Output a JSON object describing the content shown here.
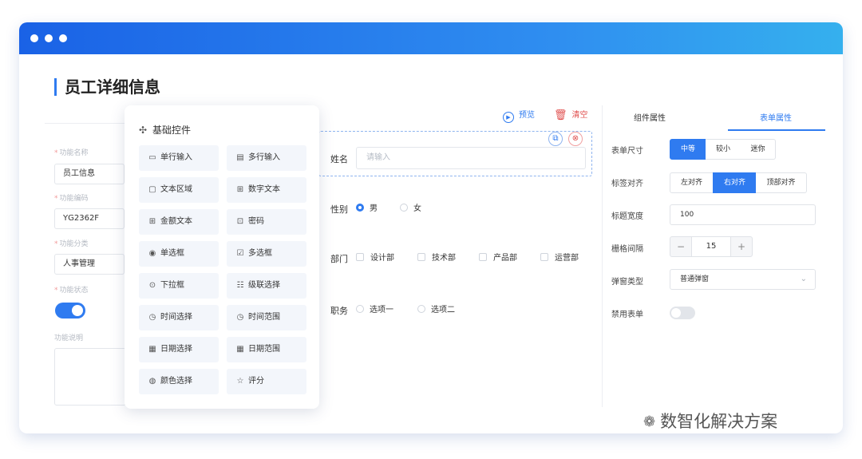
{
  "page": {
    "title": "员工详细信息"
  },
  "left_form": {
    "fields": [
      {
        "label": "功能名称",
        "value": "员工信息"
      },
      {
        "label": "功能编码",
        "value": "YG2362F"
      },
      {
        "label": "功能分类",
        "value": "人事管理"
      }
    ],
    "status_label": "功能状态",
    "status_on": true,
    "desc_label": "功能说明"
  },
  "popup": {
    "title": "基础控件",
    "controls": [
      {
        "label": "单行输入",
        "icon": "single-line-input-icon",
        "glyph": "▭"
      },
      {
        "label": "多行输入",
        "icon": "multi-line-input-icon",
        "glyph": "▤"
      },
      {
        "label": "文本区域",
        "icon": "text-area-icon",
        "glyph": "▢"
      },
      {
        "label": "数字文本",
        "icon": "number-text-icon",
        "glyph": "⊞"
      },
      {
        "label": "金额文本",
        "icon": "amount-text-icon",
        "glyph": "⊞"
      },
      {
        "label": "密码",
        "icon": "password-icon",
        "glyph": "⊡"
      },
      {
        "label": "单选框",
        "icon": "radio-icon",
        "glyph": "◉"
      },
      {
        "label": "多选框",
        "icon": "checkbox-icon",
        "glyph": "☑"
      },
      {
        "label": "下拉框",
        "icon": "dropdown-icon",
        "glyph": "⊙"
      },
      {
        "label": "级联选择",
        "icon": "cascade-select-icon",
        "glyph": "☷"
      },
      {
        "label": "时间选择",
        "icon": "time-select-icon",
        "glyph": "◷"
      },
      {
        "label": "时间范围",
        "icon": "time-range-icon",
        "glyph": "◷"
      },
      {
        "label": "日期选择",
        "icon": "date-select-icon",
        "glyph": "▦"
      },
      {
        "label": "日期范围",
        "icon": "date-range-icon",
        "glyph": "▦"
      },
      {
        "label": "颜色选择",
        "icon": "color-select-icon",
        "glyph": "◍"
      },
      {
        "label": "评分",
        "icon": "star-icon",
        "glyph": "☆"
      }
    ]
  },
  "center": {
    "preview_label": "预览",
    "clear_label": "清空",
    "name_label": "姓名",
    "name_placeholder": "请输入",
    "gender_label": "性别",
    "gender_options": [
      "男",
      "女"
    ],
    "gender_selected": 0,
    "dept_label": "部门",
    "dept_options": [
      "设计部",
      "技术部",
      "产品部",
      "运营部"
    ],
    "job_label": "职务",
    "job_options": [
      "选项一",
      "选项二"
    ]
  },
  "right_panel": {
    "tabs": [
      "组件属性",
      "表单属性"
    ],
    "active_tab": 1,
    "form_size_label": "表单尺寸",
    "form_size_options": [
      "中等",
      "较小",
      "迷你"
    ],
    "form_size_selected": 0,
    "label_align_label": "标签对齐",
    "label_align_options": [
      "左对齐",
      "右对齐",
      "顶部对齐"
    ],
    "label_align_selected": 1,
    "title_width_label": "标题宽度",
    "title_width_value": "100",
    "grid_gap_label": "栅格间隔",
    "grid_gap_value": "15",
    "grid_gap_minus": "−",
    "grid_gap_plus": "+",
    "popup_type_label": "弹窗类型",
    "popup_type_value": "普通弹窗",
    "disable_form_label": "禁用表单",
    "disable_form_on": false
  },
  "watermark": {
    "text": "数智化解决方案"
  },
  "colors": {
    "accent": "#2f7bf0",
    "danger": "#e0504f",
    "titlebar_start": "#1a62e6",
    "titlebar_end": "#35b0ee"
  }
}
